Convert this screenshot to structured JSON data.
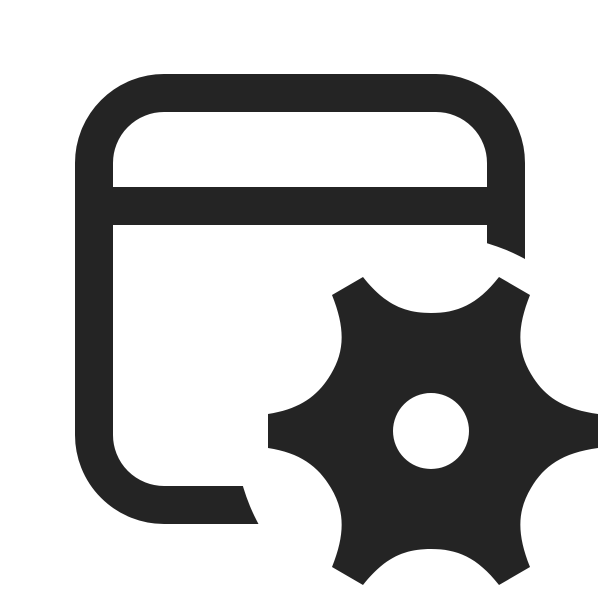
{
  "icon": {
    "name": "window-settings-icon",
    "components": [
      "window-frame-icon",
      "gear-icon"
    ],
    "color": "#242424",
    "background": "#ffffff"
  }
}
